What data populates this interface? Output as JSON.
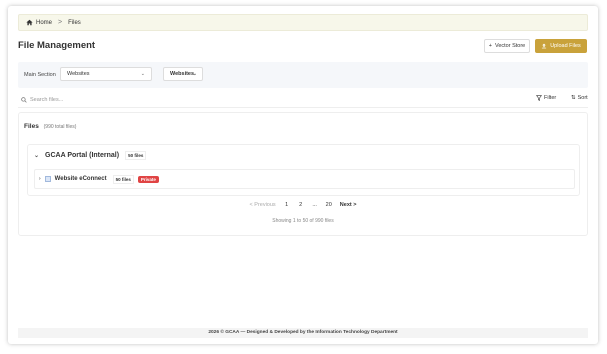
{
  "breadcrumb": {
    "home": "Home",
    "separator": ">",
    "current": "Files"
  },
  "header": {
    "title": "File Management",
    "vector_store": "Vector Store",
    "upload_files": "Upload Files"
  },
  "filters": {
    "main_section_label": "Main Section",
    "main_section_value": "Websites",
    "sub_value": "Websites"
  },
  "search": {
    "placeholder": "Search files...",
    "filter": "Filter",
    "sort": "Sort"
  },
  "files": {
    "heading": "Files",
    "total": "(990 total files)",
    "groups": [
      {
        "name": "GCAA Portal (Internal)",
        "count": "50 files",
        "items": [
          {
            "name": "Website eConnect",
            "count": "50 files",
            "badge": "Private"
          }
        ]
      }
    ]
  },
  "pagination": {
    "previous": "< Previous",
    "pages": [
      "1",
      "2",
      "...",
      "20"
    ],
    "next": "Next >",
    "info": "Showing 1 to 50 of 990 files"
  },
  "footer": {
    "text": "2026 © GCAA — Designed & Developed by the Information Technology Department"
  },
  "colors": {
    "accent": "#c9a23b",
    "private_badge": "#e04444",
    "breadcrumb_bg": "#f7f7ea",
    "filter_bg": "#f5f7fa"
  },
  "icons": [
    "home-icon",
    "plus-icon",
    "upload-icon",
    "chevron-down-icon",
    "search-icon",
    "filter-icon",
    "sort-icon",
    "chevron-right-icon",
    "folder-icon"
  ]
}
